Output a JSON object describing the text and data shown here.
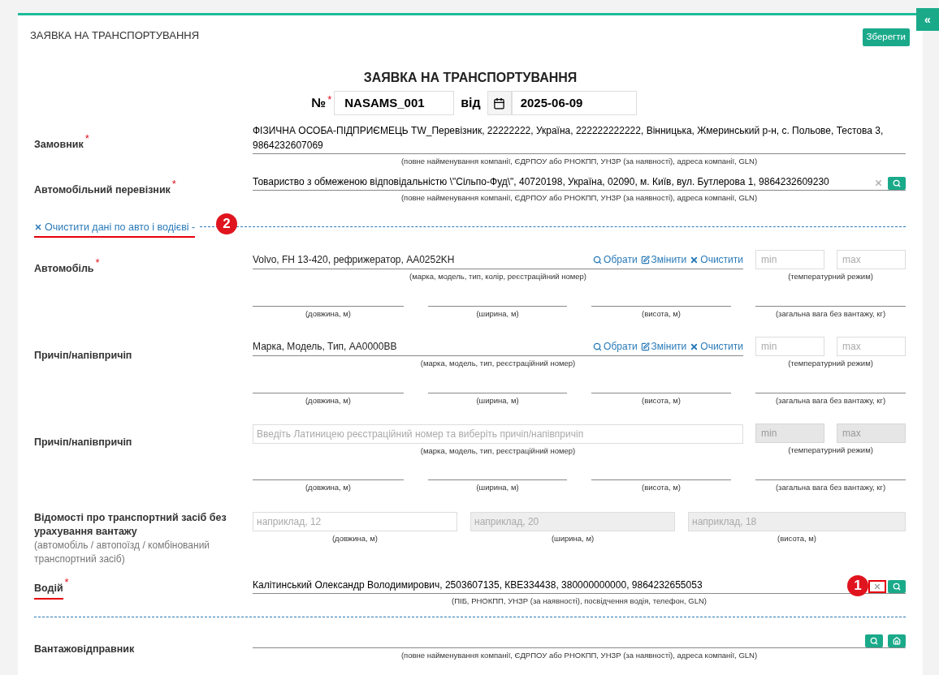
{
  "required_mark": "*",
  "header": {
    "title": "ЗАЯВКА НА ТРАНСПОРТУВАННЯ",
    "save_button": "Зберегти",
    "collapse_button": "«"
  },
  "document": {
    "title": "ЗАЯВКА НА ТРАНСПОРТУВАННЯ",
    "number_label": "№",
    "number_required": true,
    "number": "NASAMS_001",
    "date_label": "від",
    "date": "2025-06-09"
  },
  "customer": {
    "label": "Замовник",
    "required": true,
    "value": "ФІЗИЧНА ОСОБА-ПІДПРИЄМЕЦЬ TW_Перевізник, 22222222, Україна, 222222222222, Вінницька, Жмеринський р-н, с. Польове, Тестова 3, 9864232607069",
    "caption": "(повне найменування компанії, ЄДРПОУ або РНОКПП, УНЗР (за наявності), адреса компанії, GLN)"
  },
  "carrier": {
    "label": "Автомобільний перевізник",
    "required": true,
    "value": "Товариство з обмеженою відповідальністю \\\"Сільпо-Фуд\\\", 40720198, Україна, 02090, м. Київ, вул. Бутлерова 1, 9864232609230",
    "caption": "(повне найменування компанії, ЄДРПОУ або РНОКПП, УНЗР (за наявності), адреса компанії, GLN)"
  },
  "clear_link": {
    "text": "Очистити дані по авто і водієві -",
    "annotation": "2"
  },
  "vehicles": [
    {
      "label": "Автомобіль",
      "required": true,
      "value": "Volvo, FH 13-420, рефрижератор, AA0252KH",
      "caption": "(марка, модель, тип, колір, реєстраційний номер)",
      "actions": [
        {
          "kind": "search",
          "label": "Обрати"
        },
        {
          "kind": "edit",
          "label": "Змінити"
        },
        {
          "kind": "clear",
          "label": "Очистити"
        }
      ],
      "temp": {
        "min_placeholder": "min",
        "max_placeholder": "max",
        "caption": "(температурний режим)",
        "disabled": false
      },
      "dims": [
        "(довжина, м)",
        "(ширина, м)",
        "(висота, м)",
        "(загальна вага без вантажу, кг)"
      ]
    },
    {
      "label": "Причіп/напівпричіп",
      "required": false,
      "value": "Марка, Модель, Тип, AA0000BB",
      "caption": "(марка, модель, тип, реєстраційний номер)",
      "actions": [
        {
          "kind": "search",
          "label": "Обрати"
        },
        {
          "kind": "edit",
          "label": "Змінити"
        },
        {
          "kind": "clear",
          "label": "Очистити"
        }
      ],
      "temp": {
        "min_placeholder": "min",
        "max_placeholder": "max",
        "caption": "(температурний режим)",
        "disabled": false
      },
      "dims": [
        "(довжина, м)",
        "(ширина, м)",
        "(висота, м)",
        "(загальна вага без вантажу, кг)"
      ]
    },
    {
      "label": "Причіп/напівпричіп",
      "required": false,
      "placeholder": "Введіть Латиницею реєстраційний номер та виберіть причіп/напівпричіп",
      "caption": "(марка, модель, тип, реєстраційний номер)",
      "temp": {
        "min_placeholder": "min",
        "max_placeholder": "max",
        "caption": "(температурний режим)",
        "disabled": true
      },
      "dims": [
        "(довжина, м)",
        "(ширина, м)",
        "(висота, м)",
        "(загальна вага без вантажу, кг)"
      ]
    }
  ],
  "dimensions": {
    "label": "Відомості про транспортний засіб без урахування вантажу",
    "note": "(автомобіль / автопоїзд / комбінований транспортний засіб)",
    "fields": [
      {
        "placeholder": "наприклад, 12",
        "caption": "(довжина, м)",
        "disabled": false
      },
      {
        "placeholder": "наприклад, 20",
        "caption": "(ширина, м)",
        "disabled": true
      },
      {
        "placeholder": "наприклад, 18",
        "caption": "(висота, м)",
        "disabled": true
      }
    ]
  },
  "driver": {
    "label": "Водій",
    "required": true,
    "value": "Калітинський Олександр Володимирович, 2503607135, КВЕ334438, 380000000000, 9864232655053",
    "caption": "(ПІБ, РНОКПП, УНЗР (за наявності), посвідчення водія, телефон, GLN)",
    "annotation": "1"
  },
  "shipper": {
    "label": "Вантажовідправник",
    "caption": "(повне найменування компанії, ЄДРПОУ або РНОКПП, УНЗР (за наявності), адреса компанії, GLN)"
  }
}
